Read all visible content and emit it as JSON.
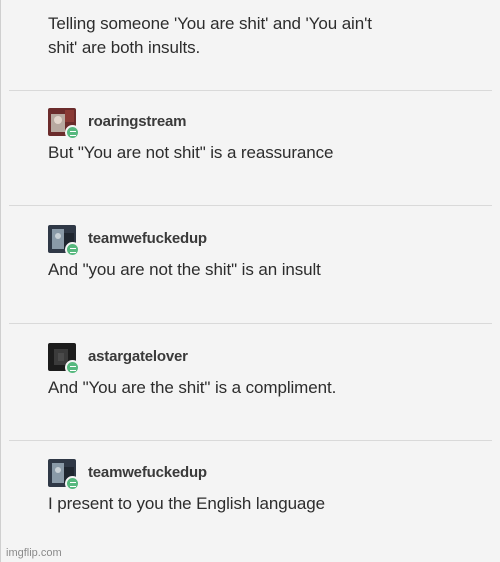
{
  "intro": {
    "line1": "Telling someone 'You are shit' and 'You ain't",
    "line2": "shit' are both insults."
  },
  "replies": [
    {
      "username": "roaringstream",
      "text": "But \"You are not shit\" is a reassurance",
      "avatar_colors": [
        "#6b2b2b",
        "#b8a9a0"
      ]
    },
    {
      "username": "teamwefuckedup",
      "text": "And \"you are not the shit\" is an insult",
      "avatar_colors": [
        "#2f3846",
        "#8a9aa8"
      ]
    },
    {
      "username": "astargatelover",
      "text": "And \"You are the shit\" is a compliment.",
      "avatar_colors": [
        "#1c1c1c",
        "#4a4a4a"
      ]
    },
    {
      "username": "teamwefuckedup",
      "text": "I present to you the English language",
      "avatar_colors": [
        "#2f3846",
        "#8a9aa8"
      ]
    }
  ],
  "watermark": "imgflip.com",
  "colors": {
    "background": "#f4f4f4",
    "text": "#2d2d2d",
    "badge": "#56b87e"
  }
}
